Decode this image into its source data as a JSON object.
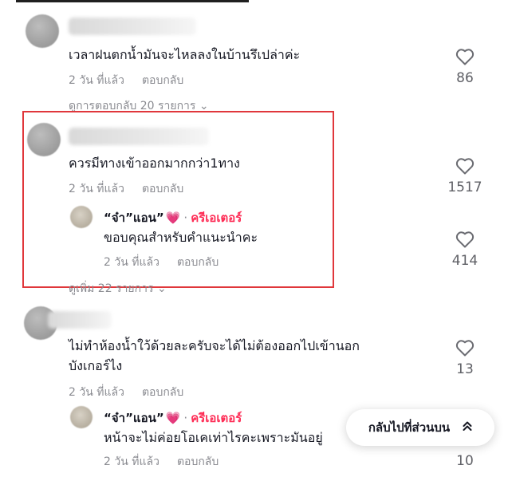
{
  "colors": {
    "highlight": "#e0373b",
    "creator": "#fe2c55",
    "heart": "#ff3b8d",
    "muted": "#8a8b91"
  },
  "c1": {
    "text": "เวลาฝนตกน้ำมันจะไหลลงในบ้านรึเปล่าค่ะ",
    "time": "2 วัน ที่แล้ว",
    "reply": "ตอบกลับ",
    "likes": "86",
    "view_replies": "ดูการตอบกลับ 20 รายการ"
  },
  "c2": {
    "text": "ควรมีทางเข้าออกมากกว่า1ทาง",
    "time": "2 วัน ที่แล้ว",
    "reply": "ตอบกลับ",
    "likes": "1517",
    "view_more": "ดูเพิ่ม 22 รายการ",
    "reply_item": {
      "name": "“จ๋า”แอน”",
      "heart": "💗",
      "dot": "·",
      "badge": "ครีเอเตอร์",
      "text": "ขอบคุณสำหรับคำแนะนำคะ",
      "time": "2 วัน ที่แล้ว",
      "reply": "ตอบกลับ",
      "likes": "414"
    }
  },
  "c3": {
    "text_line1": "ไม่ทำห้องน้ำใว้ด้วยละครับจะได้ไม่ต้องออกไปเข้านอก",
    "text_line2": "บังเกอร์ไง",
    "time": "2 วัน ที่แล้ว",
    "reply": "ตอบกลับ",
    "likes": "13",
    "reply_item": {
      "name": "“จ๋า”แอน”",
      "heart": "💗",
      "dot": "·",
      "badge": "ครีเอเตอร์",
      "text": "หน้าจะไม่ค่อยโอเคเท่าไรคะเพราะมันอยู่",
      "time": "2 วัน ที่แล้ว",
      "reply": "ตอบกลับ",
      "likes": "10"
    }
  },
  "back_to_top": {
    "label": "กลับไปที่ส่วนบน",
    "icon": "double-chevron-up-icon"
  }
}
